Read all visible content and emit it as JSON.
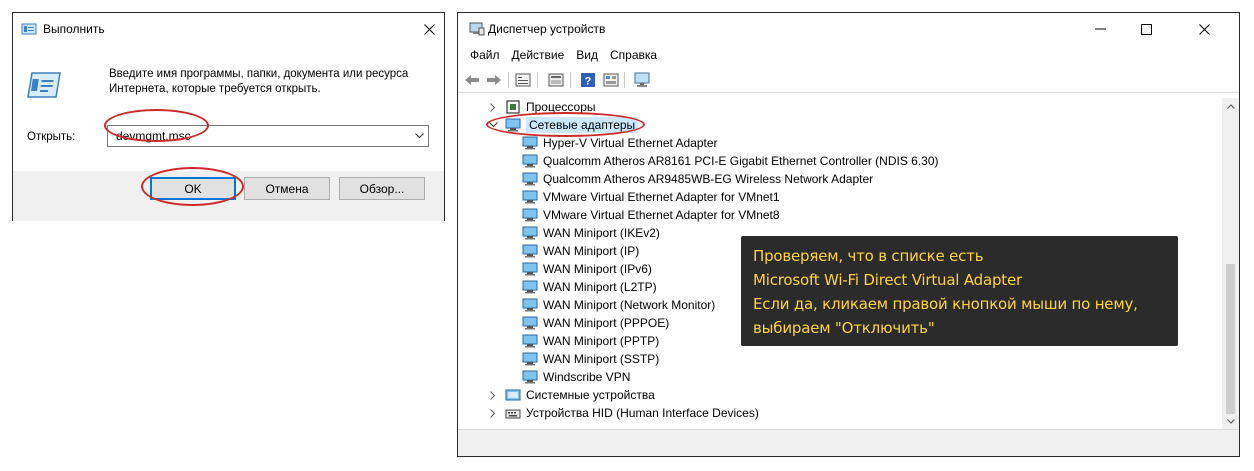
{
  "run_dialog": {
    "title": "Выполнить",
    "description": "Введите имя программы, папки, документа или ресурса Интернета, которые требуется открыть.",
    "open_label": "Открыть:",
    "input_value": "devmgmt.msc",
    "buttons": {
      "ok": "OK",
      "cancel": "Отмена",
      "browse": "Обзор..."
    },
    "icons": [
      "run-icon",
      "close-icon",
      "chevron-down-icon"
    ]
  },
  "device_manager": {
    "title": "Диспетчер устройств",
    "menu": [
      "Файл",
      "Действие",
      "Вид",
      "Справка"
    ],
    "toolbar_icons": [
      "back-icon",
      "forward-icon",
      "properties-icon",
      "update-driver-icon",
      "help-icon",
      "view-icon",
      "scan-hardware-icon"
    ],
    "tree": {
      "processors": "Процессоры",
      "network_adapters": "Сетевые адаптеры",
      "adapters": [
        "Hyper-V Virtual Ethernet Adapter",
        "Qualcomm Atheros AR8161 PCI-E Gigabit Ethernet Controller (NDIS 6.30)",
        "Qualcomm Atheros AR9485WB-EG Wireless Network Adapter",
        "VMware Virtual Ethernet Adapter for VMnet1",
        "VMware Virtual Ethernet Adapter for VMnet8",
        "WAN Miniport (IKEv2)",
        "WAN Miniport (IP)",
        "WAN Miniport (IPv6)",
        "WAN Miniport (L2TP)",
        "WAN Miniport (Network Monitor)",
        "WAN Miniport (PPPOE)",
        "WAN Miniport (PPTP)",
        "WAN Miniport (SSTP)",
        "Windscribe VPN"
      ],
      "system_devices": "Системные устройства",
      "hid_devices": "Устройства HID (Human Interface Devices)"
    }
  },
  "annotation": {
    "lines": [
      "Проверяем, что в списке есть",
      "Microsoft Wi-Fi Direct Virtual Adapter",
      "Если да, кликаем правой кнопкой мыши по нему,",
      "выбираем \"Отключить\""
    ]
  },
  "colors": {
    "highlight_ellipse": "#cc2a2a",
    "annotation_bg": "#2b2b2b",
    "annotation_text": "#ffd43b",
    "selection": "#cce8ff",
    "accent": "#0078d7"
  }
}
